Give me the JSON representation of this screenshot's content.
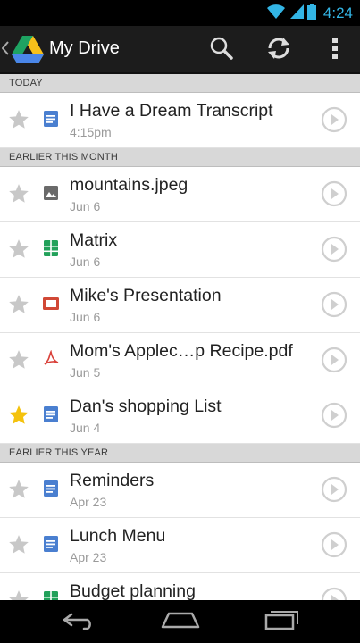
{
  "status_bar": {
    "time": "4:24",
    "wifi_icon": "wifi-icon",
    "signal_icon": "signal-icon",
    "battery_icon": "battery-icon"
  },
  "action_bar": {
    "title": "My Drive",
    "search_icon": "search-icon",
    "refresh_icon": "refresh-icon",
    "overflow_icon": "overflow-menu-icon"
  },
  "sections": [
    {
      "header": "TODAY",
      "items": [
        {
          "name": "I Have a Dream Transcript",
          "date": "4:15pm",
          "starred": false,
          "type": "doc"
        }
      ]
    },
    {
      "header": "EARLIER THIS MONTH",
      "items": [
        {
          "name": "mountains.jpeg",
          "date": "Jun 6",
          "starred": false,
          "type": "image"
        },
        {
          "name": "Matrix",
          "date": "Jun 6",
          "starred": false,
          "type": "sheet"
        },
        {
          "name": "Mike's Presentation",
          "date": "Jun 6",
          "starred": false,
          "type": "slides"
        },
        {
          "name": "Mom's Applec…p Recipe.pdf",
          "date": "Jun 5",
          "starred": false,
          "type": "pdf"
        },
        {
          "name": "Dan's shopping List",
          "date": "Jun 4",
          "starred": true,
          "type": "doc"
        }
      ]
    },
    {
      "header": "EARLIER THIS YEAR",
      "items": [
        {
          "name": "Reminders",
          "date": "Apr 23",
          "starred": false,
          "type": "doc"
        },
        {
          "name": "Lunch Menu",
          "date": "Apr 23",
          "starred": false,
          "type": "doc"
        },
        {
          "name": "Budget planning",
          "date": "",
          "starred": false,
          "type": "sheet"
        }
      ]
    }
  ],
  "colors": {
    "star_on": "#f4c20d",
    "star_off": "#c8c8c8",
    "doc": "#4a7fd0",
    "sheet": "#22a15a",
    "slides": "#d14836",
    "pdf": "#d9413a",
    "image": "#6a6a6a"
  },
  "nav_bar": {
    "back_icon": "back-icon",
    "home_icon": "home-icon",
    "recents_icon": "recent-apps-icon"
  }
}
